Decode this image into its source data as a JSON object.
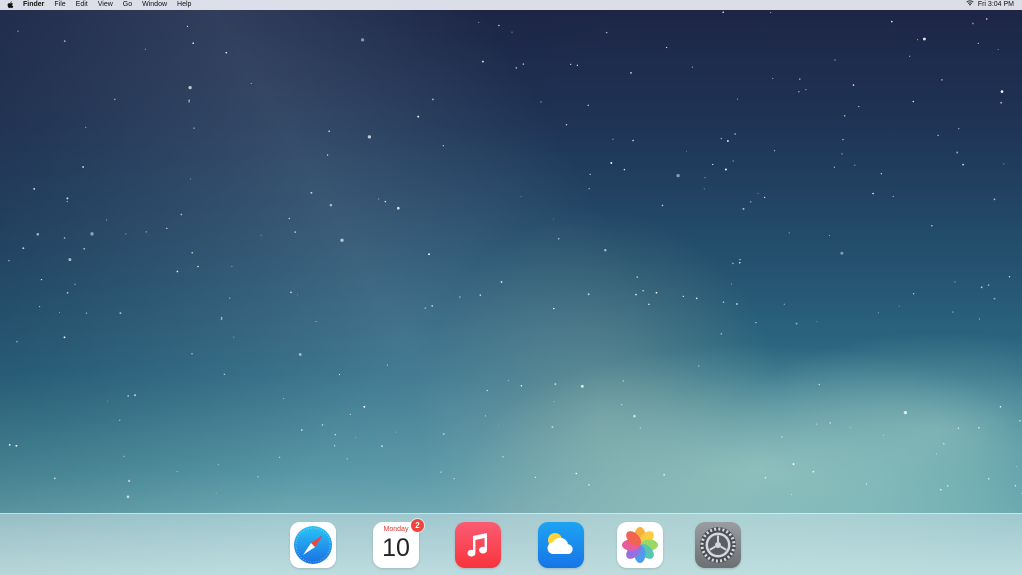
{
  "menubar": {
    "apple_icon": "apple-icon",
    "items": [
      "Finder",
      "File",
      "Edit",
      "View",
      "Go",
      "Window",
      "Help"
    ],
    "wifi_icon": "wifi-icon",
    "clock": "Fri 3:04 PM"
  },
  "dock": {
    "apps": [
      {
        "name": "Safari",
        "icon": "compass-icon"
      },
      {
        "name": "Calendar",
        "icon": "calendar-icon",
        "day": "Monday",
        "date": "10",
        "badge": "2"
      },
      {
        "name": "Music",
        "icon": "music-note-icon"
      },
      {
        "name": "Weather",
        "icon": "weather-icon"
      },
      {
        "name": "Photos",
        "icon": "photos-flower-icon"
      },
      {
        "name": "Settings",
        "icon": "gear-icon"
      }
    ]
  },
  "colors": {
    "menubar_bg": "#ebeef5",
    "badge": "#f0443c",
    "music_icon": "#f8343c",
    "weather_icon": "#1675e6"
  }
}
